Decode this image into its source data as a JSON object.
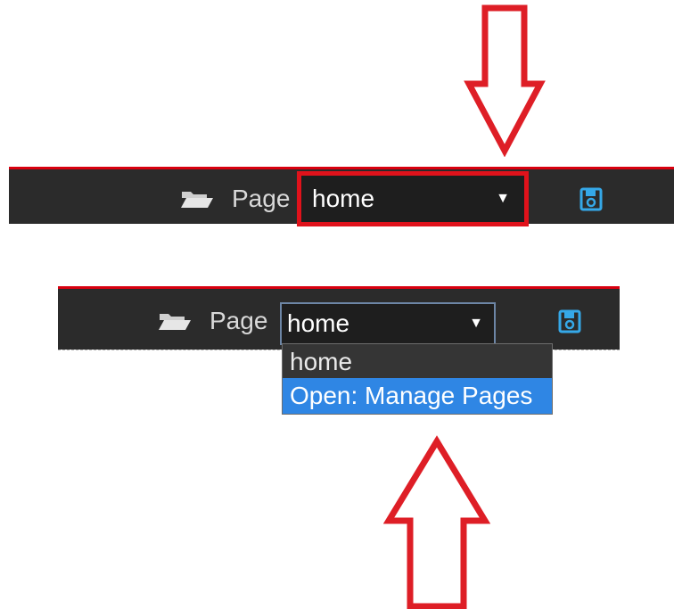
{
  "toolbar_label": "Page",
  "select": {
    "value": "home",
    "caret": "▼"
  },
  "dropdown": {
    "options": [
      {
        "label": "home",
        "highlighted": false
      },
      {
        "label": "Open: Manage Pages",
        "highlighted": true
      }
    ]
  },
  "icons": {
    "folder": "open-folder-icon",
    "save": "floppy-disk-icon",
    "annotation_down": "arrow-down-icon",
    "annotation_up": "arrow-up-icon"
  },
  "colors": {
    "toolbar_background": "#2b2b2b",
    "select_background": "#1e1e1e",
    "accent_red": "#d8000f",
    "save_icon_blue": "#35a8e8",
    "highlight_blue": "#2f86e4",
    "label_text": "#d9d9d9"
  }
}
